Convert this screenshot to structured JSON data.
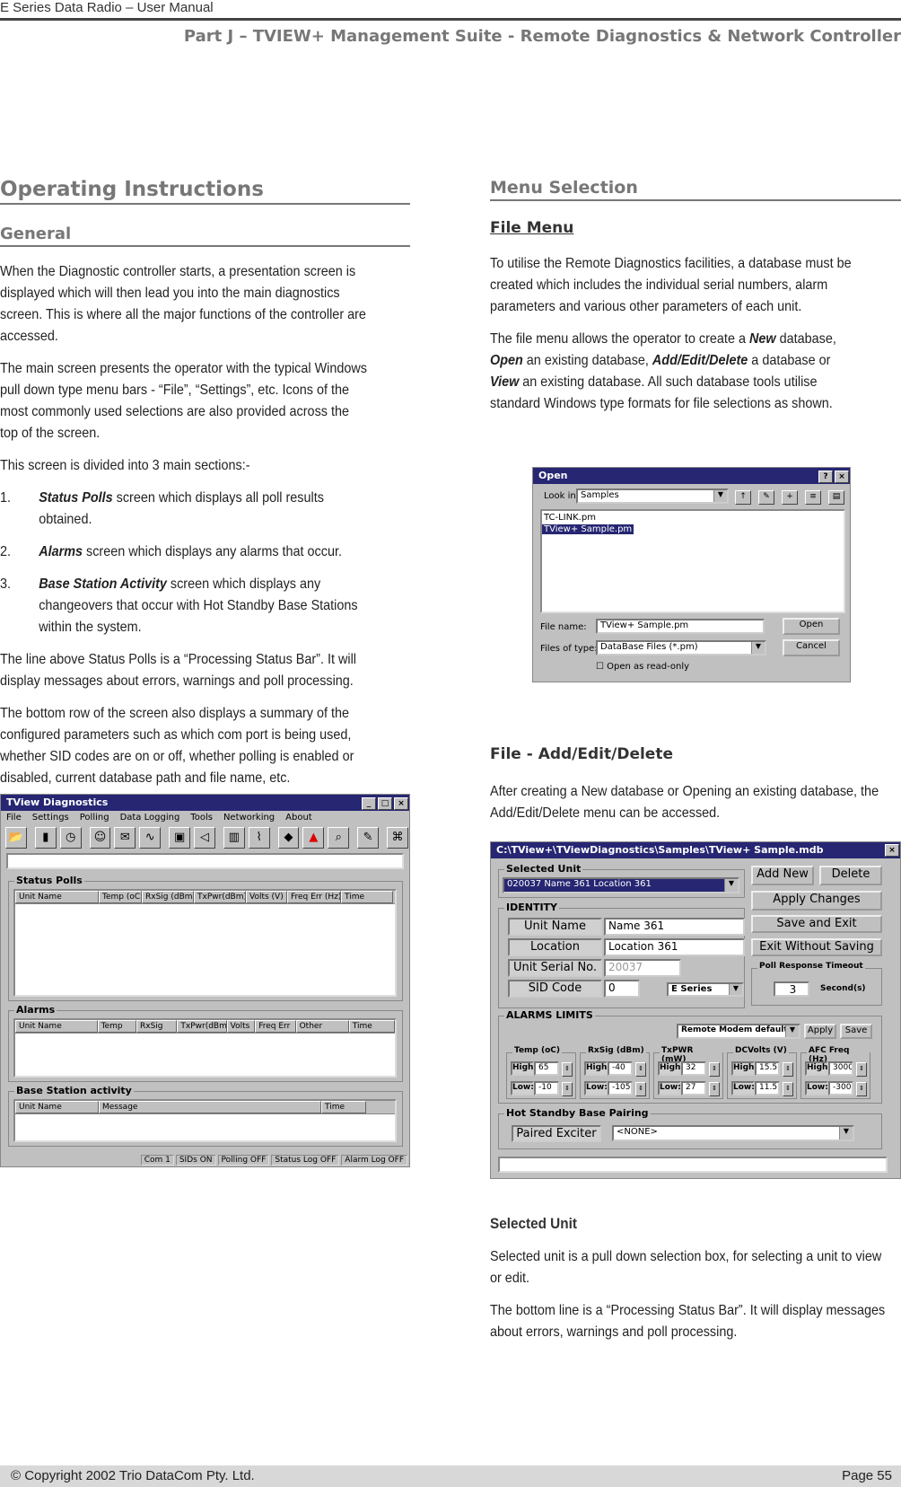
{
  "header": {
    "doc_title": "E Series Data Radio – User Manual",
    "part_title": "Part J – TVIEW+ Management Suite -  Remote Diagnostics & Network Controller"
  },
  "left": {
    "heading": "Operating  Instructions",
    "subheading": "General",
    "p1": "When the Diagnostic controller starts, a presentation screen is displayed which will then lead you into the main diagnostics screen. This is where all the major functions of the controller are accessed.",
    "p2": "The main screen presents the operator with the typical Windows pull down type menu bars - “File”, “Settings”, etc.  Icons of the most commonly used selections are also provided across the top of the screen.",
    "p3": "This screen is divided into 3 main sections:-",
    "list": [
      {
        "n": "1.",
        "term": "Status Polls",
        "text": " screen which displays all poll results obtained."
      },
      {
        "n": "2.",
        "term": "Alarms",
        "text": " screen which displays any alarms that occur."
      },
      {
        "n": "3.",
        "term": "Base Station Activity",
        "text": " screen which displays any changeovers that occur with Hot Standby Base Stations within the system."
      }
    ],
    "p4": "The line above Status Polls is a “Processing Status Bar”.  It will display messages about errors, warnings and poll processing.",
    "p5": "The bottom row of the screen also displays a summary of the configured parameters such as which com port is being used, whether SID codes are on or off, whether polling is enabled or disabled, current database path and file name, etc."
  },
  "tview": {
    "title": "TView Diagnostics",
    "menu": [
      "File",
      "Settings",
      "Polling",
      "Data Logging",
      "Tools",
      "Networking",
      "About"
    ],
    "toolbar_icons": [
      "open-folder-icon",
      "battery-icon",
      "stopwatch-icon",
      "person-icon",
      "message-icon",
      "graph-icon",
      "radio-icon",
      "speaker-icon",
      "bar-chart-icon",
      "line-chart-icon",
      "tool-icon",
      "alarm-icon",
      "search-chart-icon",
      "probe-icon",
      "network-icon"
    ],
    "status_polls": {
      "label": "Status Polls",
      "cols": [
        "Unit Name",
        "Temp (oC)",
        "RxSig (dBm)",
        "TxPwr(dBm)",
        "Volts (V)",
        "Freq Err (Hz)",
        "Time"
      ]
    },
    "alarms": {
      "label": "Alarms",
      "cols": [
        "Unit Name",
        "Temp",
        "RxSig",
        "TxPwr(dBm)",
        "Volts",
        "Freq Err",
        "Other",
        "Time"
      ]
    },
    "base": {
      "label": "Base Station activity",
      "cols": [
        "Unit Name",
        "Message",
        "Time"
      ]
    },
    "statusbar": [
      "Com 1",
      "SIDs ON",
      "Polling OFF",
      "Status Log OFF",
      "Alarm Log OFF"
    ]
  },
  "right": {
    "heading": "Menu Selection",
    "file_menu": "File Menu",
    "p1": "To utilise the Remote Diagnostics facilities, a database must be created which includes the individual serial numbers, alarm parameters and various other parameters of each unit.",
    "p2a": "The file menu allows the operator to create a ",
    "new": "New",
    "p2b": " database, ",
    "open": "Open",
    "p2c": " an existing database, ",
    "aed": "Add/Edit/Delete",
    "p2d": " a database or ",
    "view": "View",
    "p2e": " an existing database.  All such database tools utilise standard Windows type formats for file selections as shown.",
    "aed_heading": "File - Add/Edit/Delete",
    "p3": "After creating a New database or Opening an existing database, the Add/Edit/Delete menu can be accessed.",
    "sel_heading": "Selected Unit",
    "p4": "Selected unit is a pull down selection box, for selecting a unit to view or edit.",
    "p5": "The bottom line is a “Processing Status Bar”.  It will display messages about errors, warnings and poll processing."
  },
  "open_dialog": {
    "title": "Open",
    "look_in_label": "Look in:",
    "look_in": "Samples",
    "files": [
      "TC-LINK.pm",
      "TView+ Sample.pm"
    ],
    "file_name_label": "File name:",
    "file_name": "TView+ Sample.pm",
    "type_label": "Files of type:",
    "type": "DataBase Files (*.pm)",
    "open": "Open",
    "cancel": "Cancel",
    "readonly": "Open as read-only"
  },
  "edit_dialog": {
    "title": "C:\\TView+\\TViewDiagnostics\\Samples\\TView+ Sample.mdb",
    "selected_unit_label": "Selected Unit",
    "selected_unit": "020037 Name 361 Location 361",
    "identity_label": "IDENTITY",
    "unit_name_label": "Unit Name",
    "unit_name": "Name 361",
    "location_label": "Location",
    "location": "Location 361",
    "serial_label": "Unit Serial No.",
    "serial": "20037",
    "sid_label": "SID Code",
    "sid": "0",
    "series": "E Series",
    "buttons": {
      "add": "Add New",
      "delete": "Delete",
      "apply": "Apply Changes",
      "save": "Save and Exit",
      "exit": "Exit Without Saving"
    },
    "poll_label": "Poll Response Timeout",
    "poll_value": "3",
    "poll_unit": "Second(s)",
    "alarms_label": "ALARMS LIMITS",
    "defaults": "Remote Modem defaults",
    "apply": "Apply",
    "save": "Save",
    "limits": [
      {
        "name": "Temp (oC)",
        "high": "65",
        "low": "-10"
      },
      {
        "name": "RxSig (dBm)",
        "high": "-40",
        "low": "-105"
      },
      {
        "name": "TxPWR (mW)",
        "high": "32",
        "low": "27"
      },
      {
        "name": "DCVolts (V)",
        "high": "15.5",
        "low": "11.5"
      },
      {
        "name": "AFC Freq (Hz)",
        "high": "3000",
        "low": "-3000"
      }
    ],
    "high_label": "High:",
    "low_label": "Low:",
    "hot_label": "Hot Standby Base Pairing",
    "paired_label": "Paired Exciter",
    "paired": "<NONE>"
  },
  "footer": {
    "copyright": "© Copyright 2002 Trio DataCom Pty. Ltd.",
    "page": "Page 55"
  }
}
